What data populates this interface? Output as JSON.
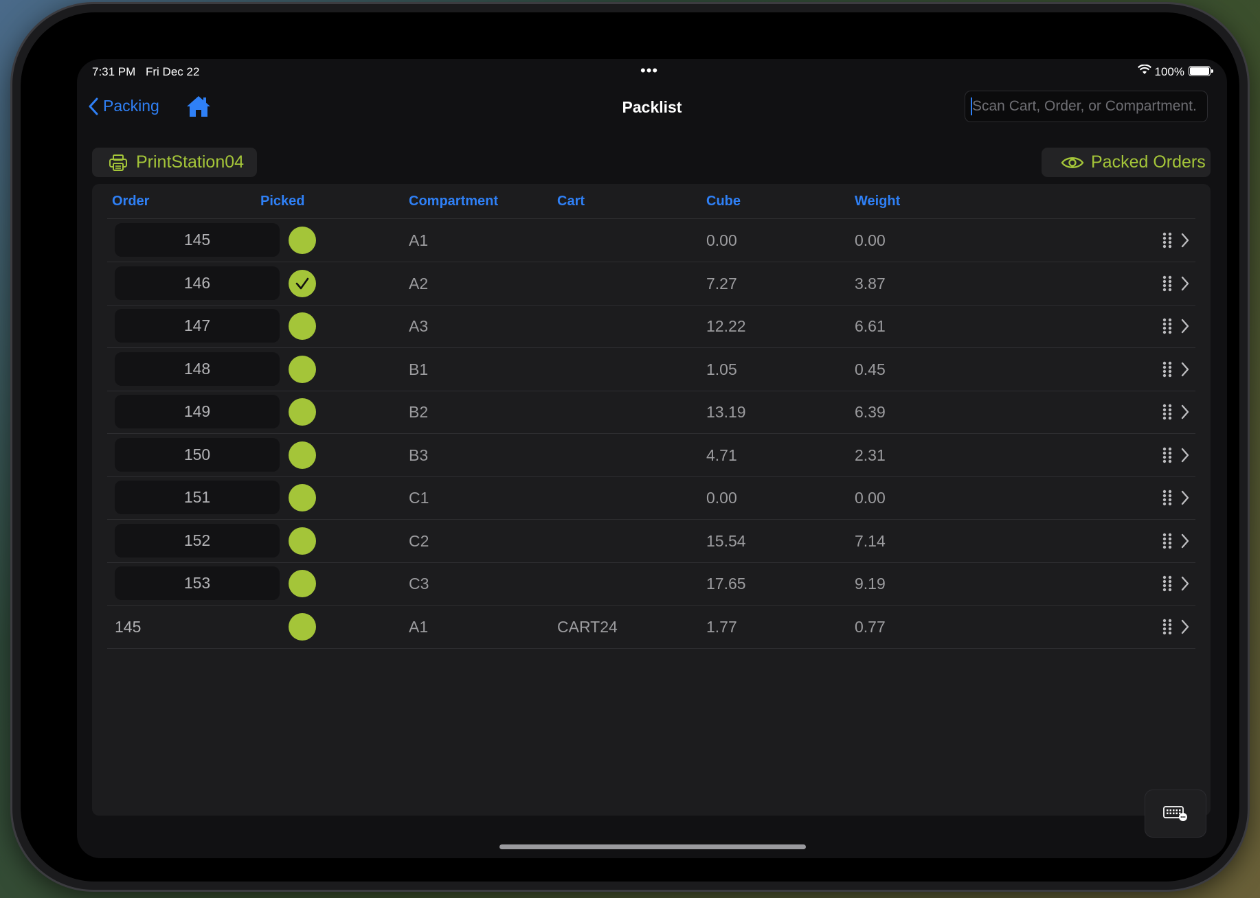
{
  "status_bar": {
    "time": "7:31 PM",
    "date": "Fri Dec 22",
    "battery_percent": "100%"
  },
  "nav": {
    "back_label": "Packing",
    "title": "Packlist",
    "search_placeholder": "Scan Cart, Order, or Compartment.",
    "search_value": ""
  },
  "toolbar": {
    "print_station_label": "PrintStation04",
    "packed_orders_label": "Packed Orders"
  },
  "table": {
    "headers": {
      "order": "Order",
      "picked": "Picked",
      "compartment": "Compartment",
      "cart": "Cart",
      "cube": "Cube",
      "weight": "Weight"
    },
    "rows": [
      {
        "order": "145",
        "picked": false,
        "compartment": "A1",
        "cart": "",
        "cube": "0.00",
        "weight": "0.00",
        "editable": true
      },
      {
        "order": "146",
        "picked": true,
        "compartment": "A2",
        "cart": "",
        "cube": "7.27",
        "weight": "3.87",
        "editable": true
      },
      {
        "order": "147",
        "picked": false,
        "compartment": "A3",
        "cart": "",
        "cube": "12.22",
        "weight": "6.61",
        "editable": true
      },
      {
        "order": "148",
        "picked": false,
        "compartment": "B1",
        "cart": "",
        "cube": "1.05",
        "weight": "0.45",
        "editable": true
      },
      {
        "order": "149",
        "picked": false,
        "compartment": "B2",
        "cart": "",
        "cube": "13.19",
        "weight": "6.39",
        "editable": true
      },
      {
        "order": "150",
        "picked": false,
        "compartment": "B3",
        "cart": "",
        "cube": "4.71",
        "weight": "2.31",
        "editable": true
      },
      {
        "order": "151",
        "picked": false,
        "compartment": "C1",
        "cart": "",
        "cube": "0.00",
        "weight": "0.00",
        "editable": true
      },
      {
        "order": "152",
        "picked": false,
        "compartment": "C2",
        "cart": "",
        "cube": "15.54",
        "weight": "7.14",
        "editable": true
      },
      {
        "order": "153",
        "picked": false,
        "compartment": "C3",
        "cart": "",
        "cube": "17.65",
        "weight": "9.19",
        "editable": true
      },
      {
        "order": "145",
        "picked": false,
        "compartment": "A1",
        "cart": "CART24",
        "cube": "1.77",
        "weight": "0.77",
        "editable": false
      }
    ]
  },
  "colors": {
    "accent_blue": "#2f80f6",
    "accent_green": "#a4c539",
    "background": "#111113",
    "panel": "#1c1c1e"
  },
  "icons": {
    "back": "chevron-left-icon",
    "home": "house-icon",
    "print": "printer-icon",
    "packed": "eye-icon",
    "row_drag": "drag-handle-icon",
    "row_disclosure": "chevron-right-icon",
    "keyboard": "keyboard-icon"
  }
}
